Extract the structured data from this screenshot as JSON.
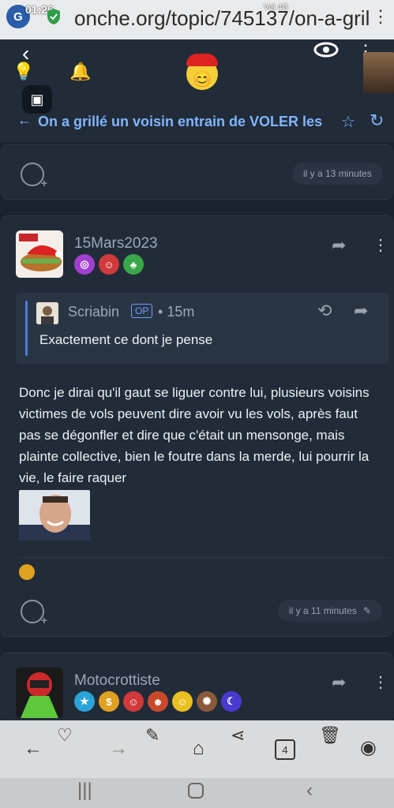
{
  "status_bar": {
    "time": "01:26",
    "indicators": "Vo) 4G"
  },
  "browser": {
    "url": "onche.org/topic/745137/on-a-gril",
    "menu_icon": "kebab-icon"
  },
  "header": {
    "topic_title": "On a grillé un voisin entrain de VOLER les",
    "icons": [
      "back-icon",
      "eye-icon",
      "bulb-icon",
      "bell-icon",
      "image-icon",
      "star-icon",
      "refresh-icon"
    ]
  },
  "posts": [
    {
      "timestamp": "il y a 13 minutes"
    },
    {
      "author": "15Mars2023",
      "quote": {
        "author": "Scriabin",
        "op_label": "OP",
        "separator": "•",
        "time": "15m",
        "text": "Exactement ce dont je pense"
      },
      "body": "Donc je dirai qu'il gaut se liguer contre lui, plusieurs voisins victimes de vols peuvent dire avoir vu les vols, après faut pas se dégonfler et dire que c'était un mensonge, mais plainte collective, bien le foutre dans la merde, lui pourrir la vie, le faire raquer",
      "timestamp": "il y a 11 minutes"
    },
    {
      "author": "Motocrottiste"
    }
  ],
  "bottom_nav": {
    "tab_count": "4"
  },
  "colors": {
    "accent": "#7fb6ff",
    "card": "#222b38",
    "background": "#1b2330"
  }
}
